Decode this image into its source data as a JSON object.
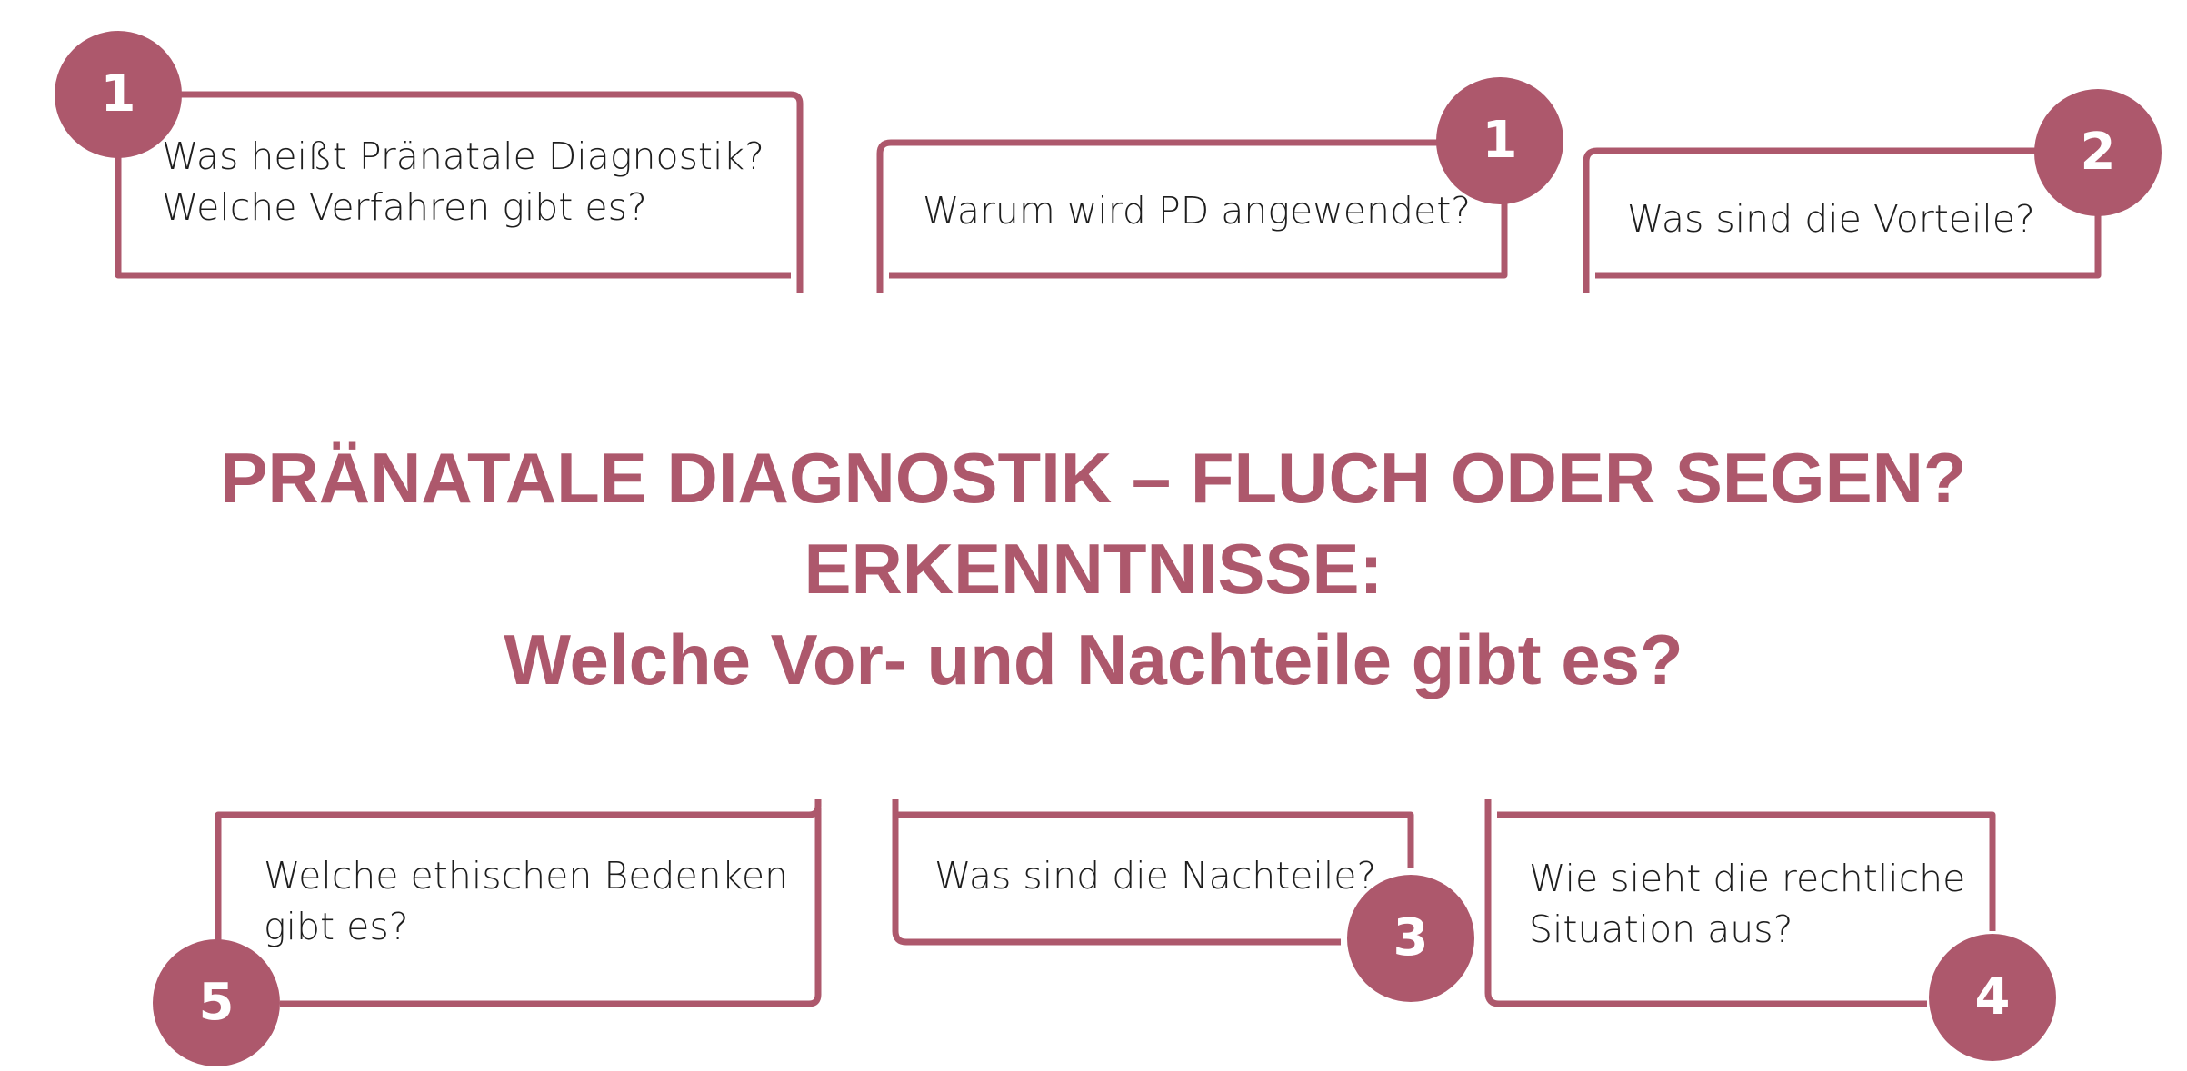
{
  "colors": {
    "accent": "#ad586c",
    "text": "#1e1e1e",
    "background": "#ffffff"
  },
  "title": {
    "line1": "PRÄNATALE DIAGNOSTIK – FLUCH ODER SEGEN?",
    "line2": "ERKENNTNISSE:",
    "line3": "Welche Vor- und Nachteile gibt es?"
  },
  "cards": [
    {
      "number": "1",
      "lines": [
        "Was heißt Pränatale Diagnostik?",
        "Welche Verfahren gibt es?"
      ]
    },
    {
      "number": "1",
      "lines": [
        "Warum wird PD angewendet?"
      ]
    },
    {
      "number": "2",
      "lines": [
        "Was sind die Vorteile?"
      ]
    },
    {
      "number": "5",
      "lines": [
        "Welche ethischen Bedenken",
        "gibt es?"
      ]
    },
    {
      "number": "3",
      "lines": [
        "Was sind die Nachteile?"
      ]
    },
    {
      "number": "4",
      "lines": [
        "Wie sieht die rechtliche",
        "Situation aus?"
      ]
    }
  ]
}
